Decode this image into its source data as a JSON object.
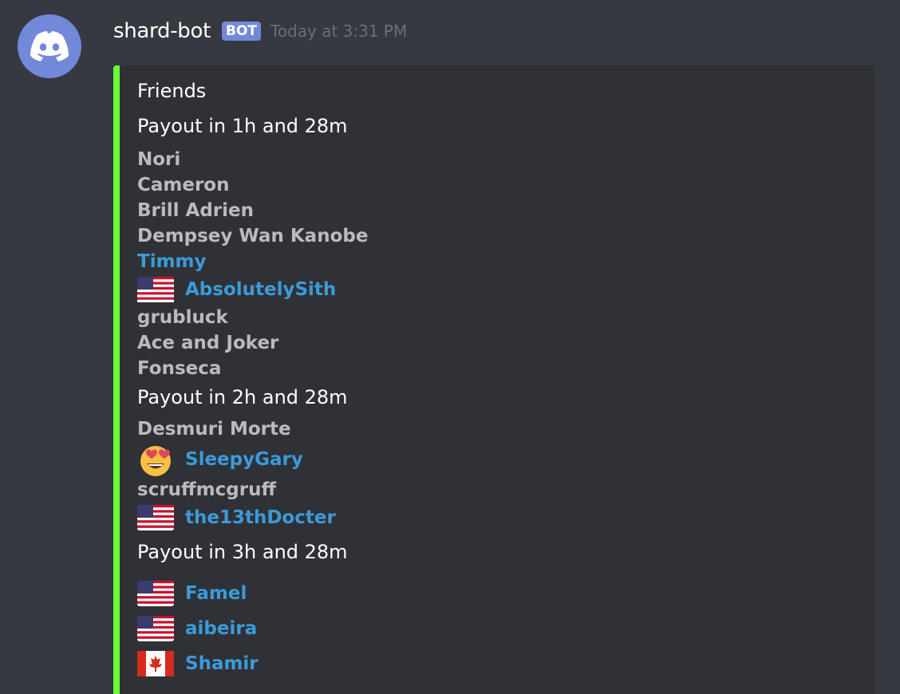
{
  "message": {
    "author": "shard-bot",
    "bot_tag": "BOT",
    "timestamp": "Today at 3:31 PM",
    "avatar_icon": "discord-logo-icon"
  },
  "embed": {
    "accent_color": "#6bff3a",
    "title": "Friends",
    "groups": [
      {
        "label": "Payout in 1h and 28m",
        "members": [
          {
            "name": "Nori",
            "linked": false,
            "icon": null
          },
          {
            "name": "Cameron",
            "linked": false,
            "icon": null
          },
          {
            "name": "Brill Adrien",
            "linked": false,
            "icon": null
          },
          {
            "name": "Dempsey Wan Kanobe",
            "linked": false,
            "icon": null
          },
          {
            "name": "Timmy",
            "linked": true,
            "icon": null
          },
          {
            "name": "AbsolutelySith",
            "linked": true,
            "icon": "us-flag-icon"
          },
          {
            "name": "grubluck",
            "linked": false,
            "icon": null
          },
          {
            "name": "Ace and Joker",
            "linked": false,
            "icon": null
          },
          {
            "name": "Fonseca",
            "linked": false,
            "icon": null
          }
        ]
      },
      {
        "label": "Payout in 2h and 28m",
        "members": [
          {
            "name": "Desmuri Morte",
            "linked": false,
            "icon": null
          },
          {
            "name": "SleepyGary",
            "linked": true,
            "icon": "heart-eyes-emoji-icon"
          },
          {
            "name": "scruffmcgruff",
            "linked": false,
            "icon": null
          },
          {
            "name": "the13thDocter",
            "linked": true,
            "icon": "us-flag-icon"
          }
        ]
      },
      {
        "label": "Payout in 3h and 28m",
        "members": [
          {
            "name": "Famel",
            "linked": true,
            "icon": "us-flag-icon"
          },
          {
            "name": "aibeira",
            "linked": true,
            "icon": "us-flag-icon"
          },
          {
            "name": "Shamir",
            "linked": true,
            "icon": "canada-flag-icon"
          }
        ]
      }
    ]
  },
  "colors": {
    "background": "#36393f",
    "embed_background": "#2f3136",
    "link": "#3b9bd9",
    "muted_name": "#b9bbbe",
    "blurple": "#7289da"
  }
}
